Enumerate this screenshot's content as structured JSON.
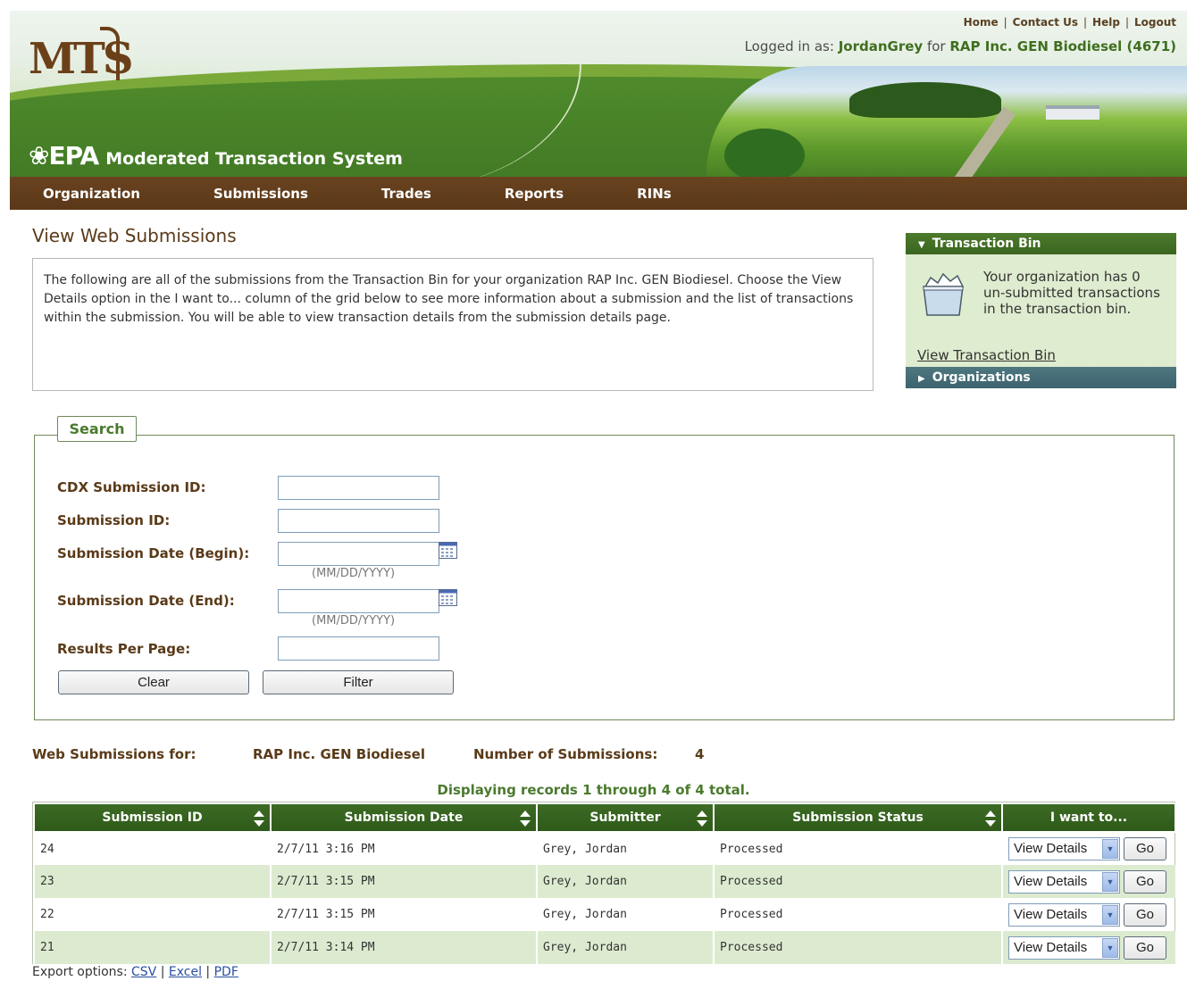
{
  "header": {
    "logo_text": "MTS",
    "epa_mark": "EPA",
    "system_name": "Moderated Transaction System",
    "top_links": [
      "Home",
      "Contact Us",
      "Help",
      "Logout"
    ],
    "logged_in_prefix": "Logged in as:",
    "username": "JordanGrey",
    "for_text": "for",
    "org_display": "RAP Inc. GEN Biodiesel (4671)"
  },
  "nav": [
    "Organization",
    "Submissions",
    "Trades",
    "Reports",
    "RINs"
  ],
  "page": {
    "title": "View Web Submissions",
    "intro": "The following are all of the submissions from the Transaction Bin for your organization RAP Inc. GEN Biodiesel. Choose the View Details option in the I want to... column of the grid below to see more information about a submission and the list of transactions within the submission. You will be able to view transaction details from the submission details page."
  },
  "side": {
    "transaction_bin_title": "Transaction Bin",
    "bin_message": "Your organization has 0 un-submitted transactions in the transaction bin.",
    "bin_link": "View Transaction Bin",
    "organizations_title": "Organizations"
  },
  "search": {
    "legend": "Search",
    "labels": {
      "cdx_id": "CDX Submission ID:",
      "submission_id": "Submission ID:",
      "date_begin": "Submission Date (Begin):",
      "date_end": "Submission Date (End):",
      "results_per_page": "Results Per Page:"
    },
    "values": {
      "cdx_id": "",
      "submission_id": "",
      "date_begin": "",
      "date_end": "",
      "results_per_page": ""
    },
    "date_hint": "(MM/DD/YYYY)",
    "clear_label": "Clear",
    "filter_label": "Filter"
  },
  "summary": {
    "for_label": "Web Submissions for:",
    "org_name": "RAP Inc. GEN Biodiesel",
    "count_label": "Number of Submissions:",
    "count": "4",
    "displaying": "Displaying records 1 through 4 of 4 total."
  },
  "grid": {
    "columns": [
      "Submission ID",
      "Submission Date",
      "Submitter",
      "Submission Status",
      "I want to..."
    ],
    "rows": [
      {
        "id": "24",
        "date": "2/7/11 3:16 PM",
        "submitter": "Grey, Jordan",
        "status": "Processed"
      },
      {
        "id": "23",
        "date": "2/7/11 3:15 PM",
        "submitter": "Grey, Jordan",
        "status": "Processed"
      },
      {
        "id": "22",
        "date": "2/7/11 3:15 PM",
        "submitter": "Grey, Jordan",
        "status": "Processed"
      },
      {
        "id": "21",
        "date": "2/7/11 3:14 PM",
        "submitter": "Grey, Jordan",
        "status": "Processed"
      }
    ],
    "action_option": "View Details",
    "go_label": "Go"
  },
  "export": {
    "label": "Export options:",
    "csv": "CSV",
    "excel": "Excel",
    "pdf": "PDF"
  },
  "colors": {
    "nav_brown": "#5a3818",
    "header_green": "#3d7423",
    "grid_header": "#2f5a1a",
    "row_alt": "#dcebd0",
    "label_brown": "#5a3a18"
  }
}
